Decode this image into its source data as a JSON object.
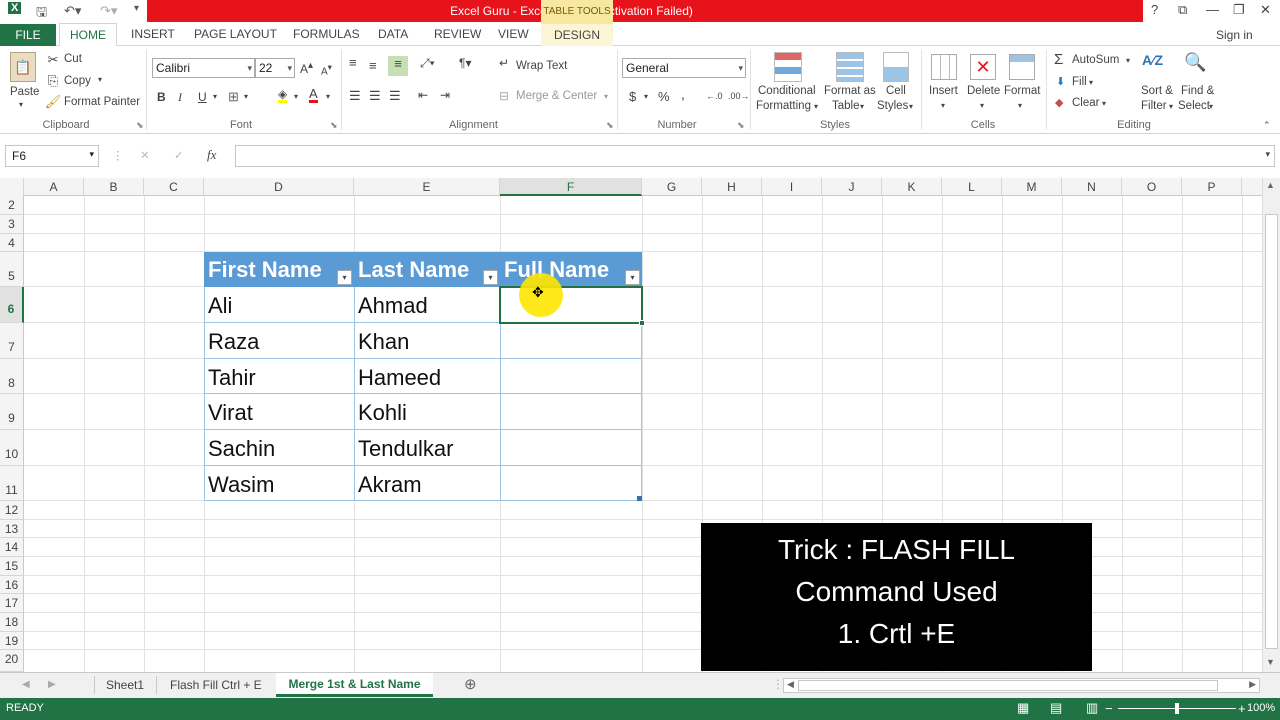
{
  "window": {
    "title": "Excel Guru -  Excel (Product Activation Failed)",
    "context_tab_group": "TABLE TOOLS",
    "accent_color": "#217346",
    "title_bar_color": "#e8131a"
  },
  "tabs": [
    "FILE",
    "HOME",
    "INSERT",
    "PAGE LAYOUT",
    "FORMULAS",
    "DATA",
    "REVIEW",
    "VIEW",
    "DESIGN"
  ],
  "signin": "Sign in",
  "ribbon": {
    "clipboard": {
      "paste": "Paste",
      "cut": "Cut",
      "copy": "Copy",
      "format_painter": "Format Painter",
      "label": "Clipboard"
    },
    "font": {
      "name": "Calibri",
      "size": "22",
      "label": "Font"
    },
    "alignment": {
      "wrap": "Wrap Text",
      "merge": "Merge & Center",
      "label": "Alignment"
    },
    "number": {
      "format": "General",
      "label": "Number"
    },
    "styles": {
      "conditional_1": "Conditional",
      "conditional_2": "Formatting",
      "format_table_1": "Format as",
      "format_table_2": "Table",
      "cell_styles_1": "Cell",
      "cell_styles_2": "Styles",
      "label": "Styles"
    },
    "cells": {
      "insert": "Insert",
      "delete": "Delete",
      "format": "Format",
      "label": "Cells"
    },
    "editing": {
      "autosum": "AutoSum",
      "fill": "Fill",
      "clear": "Clear",
      "sort_1": "Sort &",
      "sort_2": "Filter",
      "find_1": "Find &",
      "find_2": "Select",
      "label": "Editing"
    }
  },
  "formula_bar": {
    "name_box": "F6",
    "fx": "fx",
    "value": ""
  },
  "columns": [
    "A",
    "B",
    "C",
    "D",
    "E",
    "F",
    "G",
    "H",
    "I",
    "J",
    "K",
    "L",
    "M",
    "N",
    "O",
    "P"
  ],
  "rows": [
    "2",
    "3",
    "4",
    "5",
    "6",
    "7",
    "8",
    "9",
    "10",
    "11",
    "12",
    "13",
    "14",
    "15",
    "16",
    "17",
    "18",
    "19",
    "20"
  ],
  "selected_cell": "F6",
  "table": {
    "headers": [
      "First Name",
      "Last Name",
      "Full Name"
    ],
    "rows": [
      [
        "Ali",
        "Ahmad",
        ""
      ],
      [
        "Raza",
        "Khan",
        ""
      ],
      [
        "Tahir",
        "Hameed",
        ""
      ],
      [
        "Virat",
        "Kohli",
        ""
      ],
      [
        "Sachin",
        "Tendulkar",
        ""
      ],
      [
        "Wasim",
        "Akram",
        ""
      ]
    ]
  },
  "trick_box": {
    "line1": "Trick : FLASH FILL",
    "line2": "Command Used",
    "line3": "1.  Crtl +E"
  },
  "sheets": [
    "Sheet1",
    "Flash Fill Ctrl + E",
    "Merge 1st & Last Name"
  ],
  "active_sheet": "Merge 1st & Last Name",
  "status": {
    "mode": "READY",
    "zoom": "100%"
  }
}
